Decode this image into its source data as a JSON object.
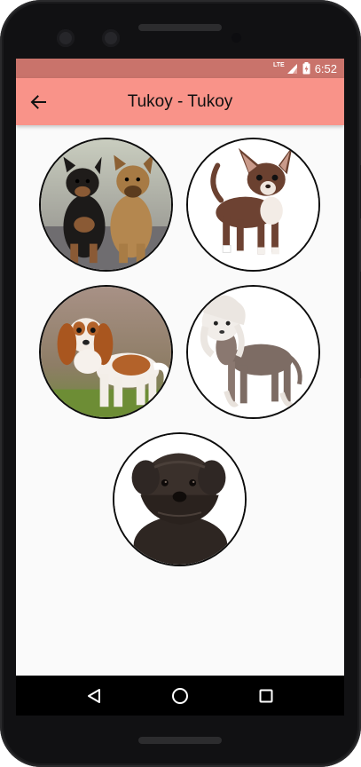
{
  "status_bar": {
    "network": "LTE",
    "time": "6:52"
  },
  "app_bar": {
    "back_icon": "arrow-back-icon",
    "title": "Tukoy - Tukoy"
  },
  "breeds": [
    {
      "id": "brussels-griffon",
      "image": "dog-photo"
    },
    {
      "id": "chihuahua",
      "image": "dog-photo"
    },
    {
      "id": "cavalier-king-charles-spaniel",
      "image": "dog-photo"
    },
    {
      "id": "chinese-crested",
      "image": "dog-photo"
    },
    {
      "id": "affenpinscher",
      "image": "dog-photo"
    }
  ],
  "nav_bar": {
    "back_icon": "triangle-back-icon",
    "home_icon": "circle-home-icon",
    "recents_icon": "square-recents-icon"
  },
  "colors": {
    "status_bar": "#c9736b",
    "app_bar": "#f99389",
    "background": "#fafafa",
    "nav_bar": "#000000",
    "circle_border": "#0d0d0d"
  }
}
